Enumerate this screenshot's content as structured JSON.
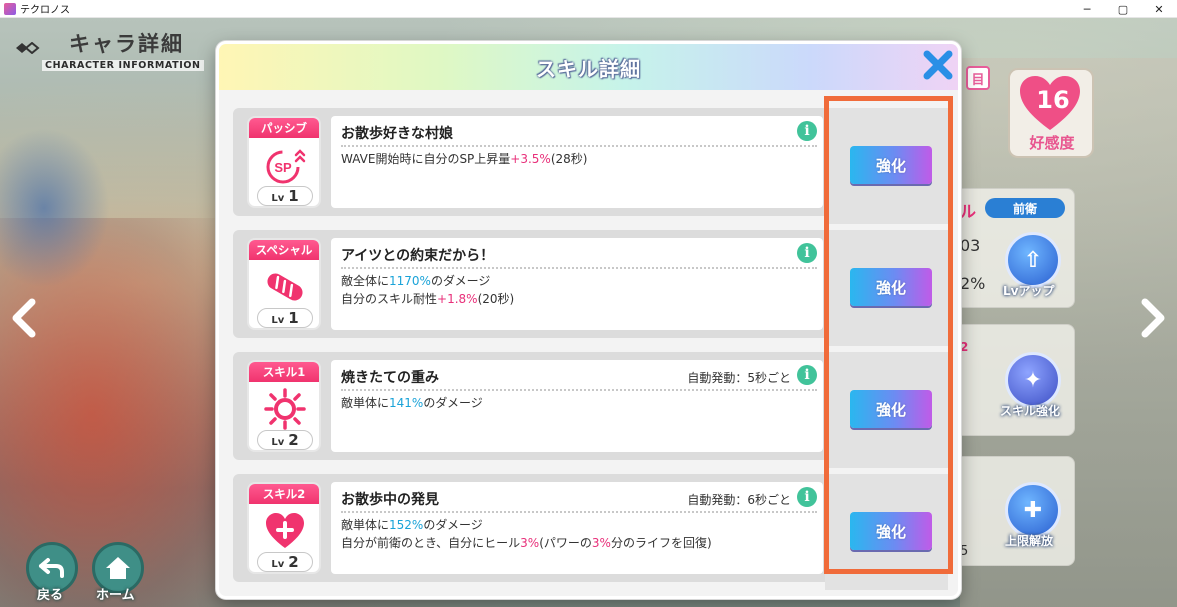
{
  "window": {
    "title": "テクロノス",
    "minimize": "─",
    "restore": "▢",
    "close": "✕"
  },
  "background": {
    "char_info_title": "キャラ詳細",
    "char_info_subtitle": "CHARACTER INFORMATION",
    "back_label": "戻る",
    "home_label": "ホーム",
    "affection_value": "16",
    "affection_label": "好感度",
    "front_label": "前衛",
    "lv_up_label": "Lvアップ",
    "skill_enhance_label": "スキル強化",
    "limit_break_label": "上限解放",
    "partial_text_1": "03",
    "partial_text_2": "2%",
    "partial_text_3": "ル",
    "partial_text_4": "2",
    "partial_text_5": "5"
  },
  "modal": {
    "title": "スキル詳細",
    "enhance_label": "強化",
    "skills": [
      {
        "type": "パッシブ",
        "icon": "sp-up-icon",
        "lv_prefix": "Lv",
        "lv": "1",
        "name": "お散歩好きな村娘",
        "auto": "",
        "desc": [
          [
            {
              "t": "WAVE開始時に自分のSP上昇量"
            },
            {
              "t": "+3.5%",
              "c": "pink"
            },
            {
              "t": "(28秒)"
            }
          ]
        ]
      },
      {
        "type": "スペシャル",
        "icon": "bread-icon",
        "lv_prefix": "Lv",
        "lv": "1",
        "name": "アイツとの約束だから！",
        "auto": "",
        "desc": [
          [
            {
              "t": "敵全体に"
            },
            {
              "t": "1170%",
              "c": "blue"
            },
            {
              "t": "のダメージ"
            }
          ],
          [
            {
              "t": "自分のスキル耐性"
            },
            {
              "t": "+1.8%",
              "c": "pink"
            },
            {
              "t": "(20秒)"
            }
          ]
        ]
      },
      {
        "type": "スキル1",
        "icon": "sun-burst-icon",
        "lv_prefix": "Lv",
        "lv": "2",
        "name": "焼きたての重み",
        "auto": "自動発動：5秒ごと",
        "desc": [
          [
            {
              "t": "敵単体に"
            },
            {
              "t": "141%",
              "c": "blue"
            },
            {
              "t": "のダメージ"
            }
          ]
        ]
      },
      {
        "type": "スキル2",
        "icon": "heart-plus-icon",
        "lv_prefix": "Lv",
        "lv": "2",
        "name": "お散歩中の発見",
        "auto": "自動発動：6秒ごと",
        "desc": [
          [
            {
              "t": "敵単体に"
            },
            {
              "t": "152%",
              "c": "blue"
            },
            {
              "t": "のダメージ"
            }
          ],
          [
            {
              "t": "自分が前衛のとき、自分にヒール"
            },
            {
              "t": "3%",
              "c": "pink"
            },
            {
              "t": "(パワーの"
            },
            {
              "t": "3%",
              "c": "pink"
            },
            {
              "t": "分のライフを回復)"
            }
          ]
        ]
      }
    ]
  },
  "colors": {
    "accent_pink": "#f0336e",
    "highlight_blue": "#1aa3d8",
    "highlight_pink": "#e8307a",
    "annotation_orange": "#f06b3a",
    "info_green": "#41c39a"
  }
}
